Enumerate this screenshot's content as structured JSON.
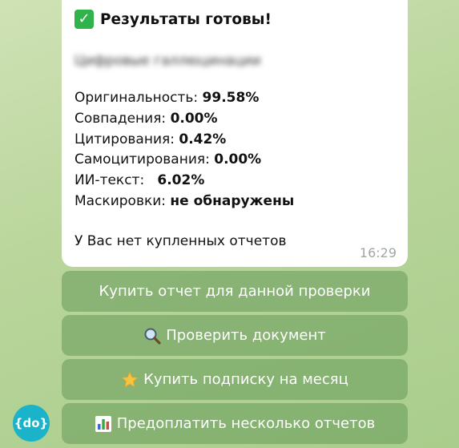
{
  "message": {
    "title": "Результаты готовы!",
    "check_icon": "✓",
    "blurred_text": "Цифровые галлюцинации",
    "stats": [
      {
        "label": "Оригинальность: ",
        "value": "99.58%"
      },
      {
        "label": "Совпадения: ",
        "value": "0.00%"
      },
      {
        "label": "Цитирования: ",
        "value": "0.42%"
      },
      {
        "label": "Самоцитирования: ",
        "value": "0.00%"
      },
      {
        "label": "ИИ-текст:   ",
        "value": "6.02%"
      },
      {
        "label": "Маскировки: ",
        "value": "не обнаружены"
      }
    ],
    "note": "У Вас нет купленных отчетов",
    "time": "16:29"
  },
  "keyboard": {
    "buy_report": "Купить отчет для данной проверки",
    "check_document": "Проверить документ",
    "buy_subscription": "Купить подписку на месяц",
    "prepay_reports": "Предоплатить несколько отчетов"
  },
  "avatar": {
    "text": "{do}",
    "color": "#1ab3c9"
  },
  "colors": {
    "button_bg": "#6ea05f",
    "check_green": "#2fb34a",
    "star": "#f5c542"
  }
}
